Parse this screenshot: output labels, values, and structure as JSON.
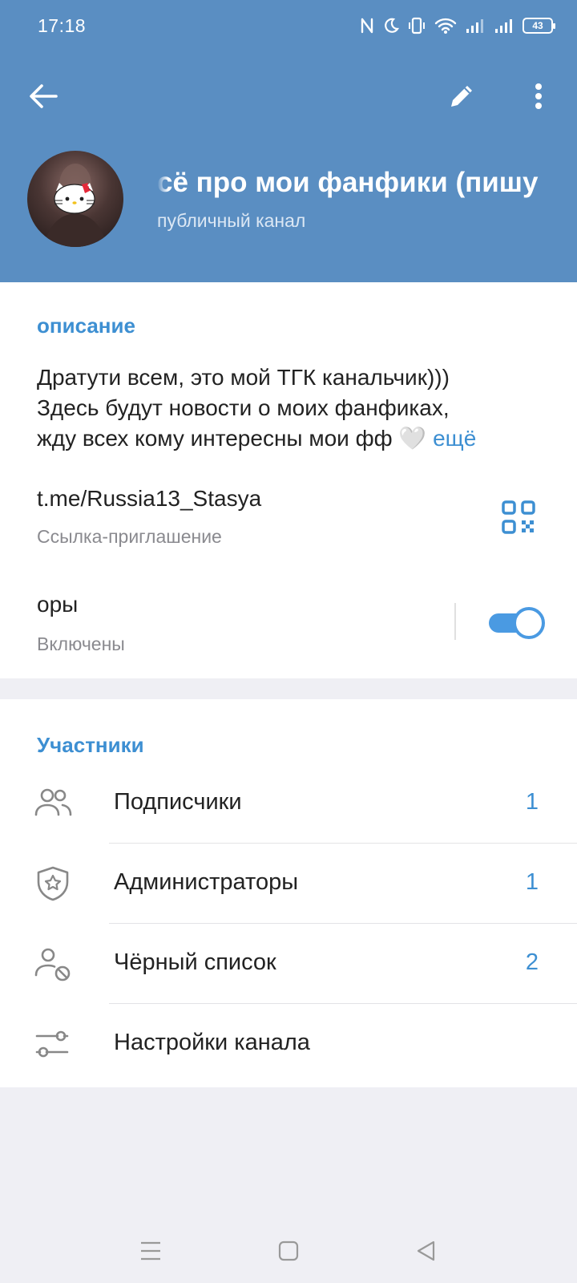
{
  "status_bar": {
    "time": "17:18",
    "battery": "43"
  },
  "header": {
    "channel_title": "сё про мои фанфики (пишу",
    "channel_subtitle": "публичный канал",
    "bg_color": "#5a8ec2"
  },
  "info": {
    "description_title": "описание",
    "description_lines": [
      "Дратути всем, это мой ТГК канальчик)))",
      "Здесь будут новости о моих фанфиках,",
      "жду всех кому интересны мои фф"
    ],
    "heart_emoji": "🤍",
    "more_label": "ещё",
    "link": "t.me/Russia13_Stasya",
    "link_caption": "Ссылка-приглашение",
    "signatures_label": "оры",
    "signatures_status": "Включены",
    "signatures_enabled": true
  },
  "members": {
    "title": "Участники",
    "items": [
      {
        "label": "Подписчики",
        "count": "1",
        "icon": "users-icon"
      },
      {
        "label": "Администраторы",
        "count": "1",
        "icon": "shield-star-icon"
      },
      {
        "label": "Чёрный список",
        "count": "2",
        "icon": "user-blocked-icon"
      },
      {
        "label": "Настройки канала",
        "count": "",
        "icon": "sliders-icon"
      }
    ]
  },
  "accent_color": "#3d8fd2"
}
